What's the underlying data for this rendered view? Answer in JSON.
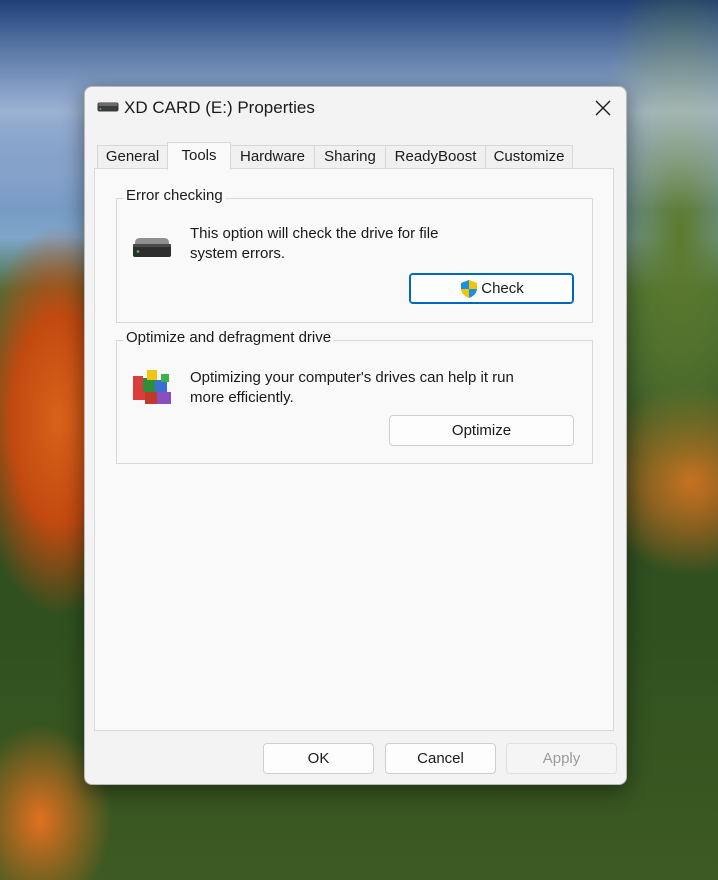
{
  "window": {
    "title": "XD CARD (E:) Properties"
  },
  "tabs": [
    {
      "label": "General"
    },
    {
      "label": "Tools"
    },
    {
      "label": "Hardware"
    },
    {
      "label": "Sharing"
    },
    {
      "label": "ReadyBoost"
    },
    {
      "label": "Customize"
    }
  ],
  "active_tab": "Tools",
  "error_checking": {
    "title": "Error checking",
    "description_line1": "This option will check the drive for file",
    "description_line2": "system errors.",
    "button_label": "Check",
    "icon": "drive-icon",
    "button_icon": "uac-shield-icon"
  },
  "optimize": {
    "title": "Optimize and defragment drive",
    "description_line1": "Optimizing your computer's drives can help it run",
    "description_line2": "more efficiently.",
    "button_label": "Optimize",
    "icon": "defrag-icon"
  },
  "footer": {
    "ok": "OK",
    "cancel": "Cancel",
    "apply": "Apply"
  },
  "colors": {
    "accent": "#0067c0",
    "dialog_bg": "#f3f3f3",
    "panel_bg": "#f9f9f9"
  }
}
